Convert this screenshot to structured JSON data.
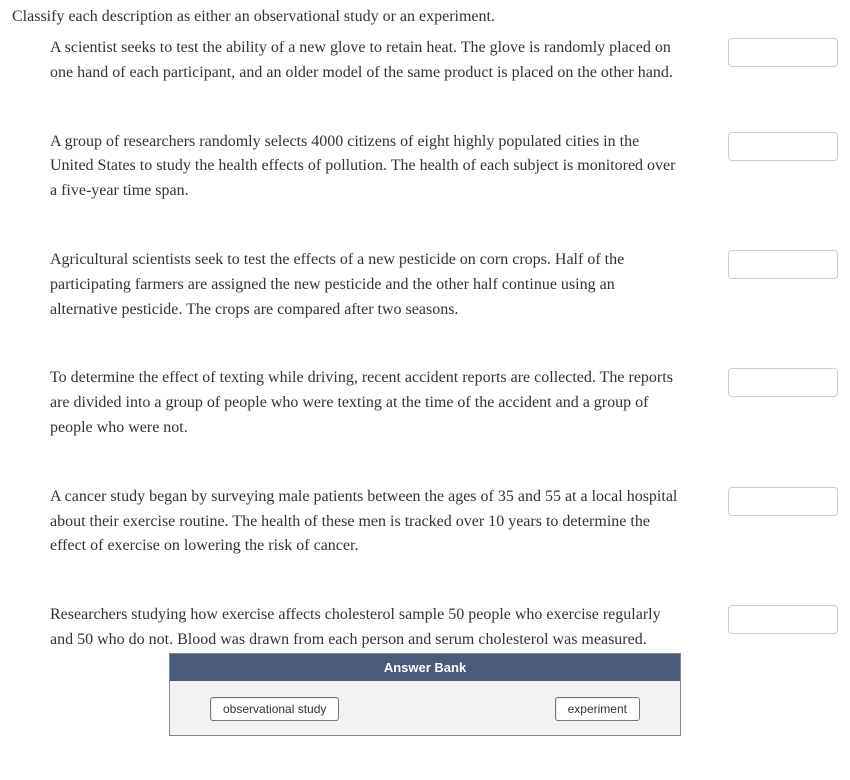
{
  "instruction": "Classify each description as either an observational study or an experiment.",
  "questions": [
    {
      "text": "A scientist seeks to test the ability of a new glove to retain heat. The glove is randomly placed on one hand of each participant, and an older model of the same product is placed on the other hand."
    },
    {
      "text": "A group of researchers randomly selects 4000 citizens of eight highly populated cities in the United States to study the health effects of pollution. The health of each subject is monitored over a five-year time span."
    },
    {
      "text": "Agricultural scientists seek to test the effects of a new pesticide on corn crops. Half of the participating farmers are assigned the new pesticide and the other half continue using an alternative pesticide. The crops are compared after two seasons."
    },
    {
      "text": "To determine the effect of texting while driving, recent accident reports are collected. The reports are divided into a group of people who were texting at the time of the accident and a group of people who were not."
    },
    {
      "text": "A cancer study began by surveying male patients between the ages of 35 and 55 at a local hospital about their exercise routine. The health of these men is tracked over 10 years to determine the effect of exercise on lowering the risk of cancer."
    },
    {
      "text": "Researchers studying how exercise affects cholesterol sample 50 people who exercise regularly and 50 who do not. Blood was drawn from each person and serum cholesterol was measured."
    }
  ],
  "answerBank": {
    "title": "Answer Bank",
    "options": [
      "observational study",
      "experiment"
    ]
  }
}
